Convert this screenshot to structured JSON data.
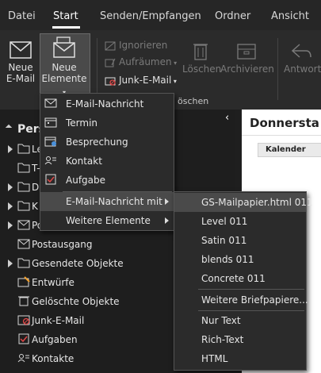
{
  "tabs": {
    "datei": "Datei",
    "start": "Start",
    "senden": "Senden/Empfangen",
    "ordner": "Ordner",
    "ansicht": "Ansicht"
  },
  "ribbon": {
    "new_email": [
      "Neue",
      "E-Mail"
    ],
    "new_items": [
      "Neue",
      "Elemente"
    ],
    "ignore": "Ignorieren",
    "cleanup": "Aufräumen",
    "junk": "Junk-E-Mail",
    "delete": "Löschen",
    "archive": "Archivieren",
    "reply": "Antworte",
    "group_label_partial": "öschen"
  },
  "new_items_menu": {
    "items": [
      {
        "label": "E-Mail-Nachricht",
        "icon": "mail-icon"
      },
      {
        "label": "Termin",
        "icon": "calendar-icon"
      },
      {
        "label": "Besprechung",
        "icon": "meeting-icon"
      },
      {
        "label": "Kontakt",
        "icon": "contact-icon"
      },
      {
        "label": "Aufgabe",
        "icon": "task-icon"
      },
      {
        "label": "E-Mail-Nachricht mit"
      },
      {
        "label": "Weitere Elemente"
      }
    ]
  },
  "stationery_menu": {
    "items": [
      "GS-Mailpapier.html 011",
      "Level 011",
      "Satin 011",
      "blends 011",
      "Concrete 011",
      "Weitere Briefpapiere...",
      "Nur Text",
      "Rich-Text",
      "HTML"
    ]
  },
  "folder_pane": {
    "root": "Pers",
    "folders": [
      {
        "label": "Le",
        "arrow": true
      },
      {
        "label": "T-",
        "arrow": false
      },
      {
        "label": "D",
        "arrow": true
      },
      {
        "label": "K",
        "arrow": true
      },
      {
        "label": "Po",
        "arrow": true
      },
      {
        "label": "Postausgang",
        "arrow": false
      },
      {
        "label": "Gesendete Objekte",
        "arrow": true
      },
      {
        "label": "Entwürfe",
        "arrow": false
      },
      {
        "label": "Gelöschte Objekte",
        "arrow": false
      },
      {
        "label": "Junk-E-Mail",
        "arrow": false
      },
      {
        "label": "Aufgaben",
        "arrow": false
      },
      {
        "label": "Kontakte",
        "arrow": false
      }
    ]
  },
  "reading_pane": {
    "header": "Donnersta",
    "calendar_label": "Kalender"
  },
  "colors": {
    "accent": "#ffffff",
    "menu_bg": "#2b2b2b",
    "highlight": "#4a4a4a"
  }
}
